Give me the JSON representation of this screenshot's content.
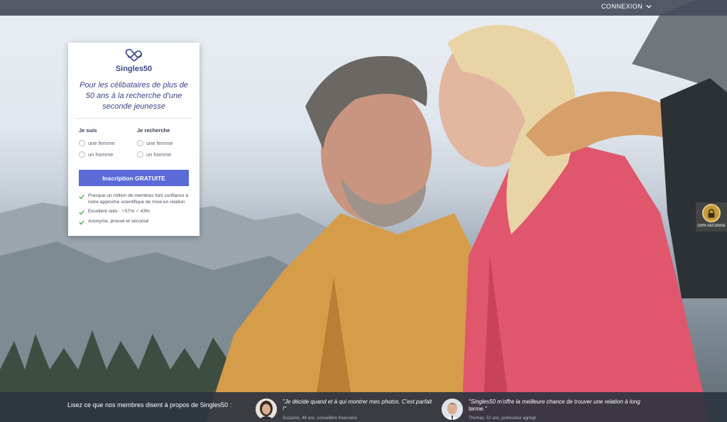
{
  "header": {
    "login_label": "CONNEXION"
  },
  "card": {
    "brand": "Singles50",
    "tagline": "Pour les célibataires de plus de 50 ans à la recherche d'une seconde jeunesse",
    "i_am": {
      "title": "Je suis",
      "options": [
        "une femme",
        "un homme"
      ]
    },
    "seeking": {
      "title": "Je recherche",
      "options": [
        "une femme",
        "un homme"
      ]
    },
    "cta_label": "Inscription GRATUITE",
    "features": [
      "Presque un million de membres font confiance à notre approche scientifique de mise en relation",
      "Excellent ratio : ♀57% ♂ 43%",
      "Anonyme, prouvé et sécurisé"
    ]
  },
  "security_badge": {
    "label": "100% SECURISE"
  },
  "testimonials": {
    "intro": "Lisez ce que nos membres disent à propos de Singles50 :",
    "items": [
      {
        "quote": "\"Je décide quand et à qui montrer mes photos. C'est parfait !\"",
        "author": "Suzanne, 48 ans, conseillère financière"
      },
      {
        "quote": "\"Singles50 m'offre la meilleure chance de trouver une relation à long terme.\"",
        "author": "Thomas, 52 ans, professeur agrégé"
      }
    ]
  },
  "colors": {
    "brand": "#3a4787",
    "cta": "#5a6ad7",
    "check": "#3fa84b",
    "topbar": "#464c5c"
  },
  "icons": [
    "heart-infinity-logo-icon",
    "chevron-down-icon",
    "check-icon",
    "lock-icon"
  ]
}
